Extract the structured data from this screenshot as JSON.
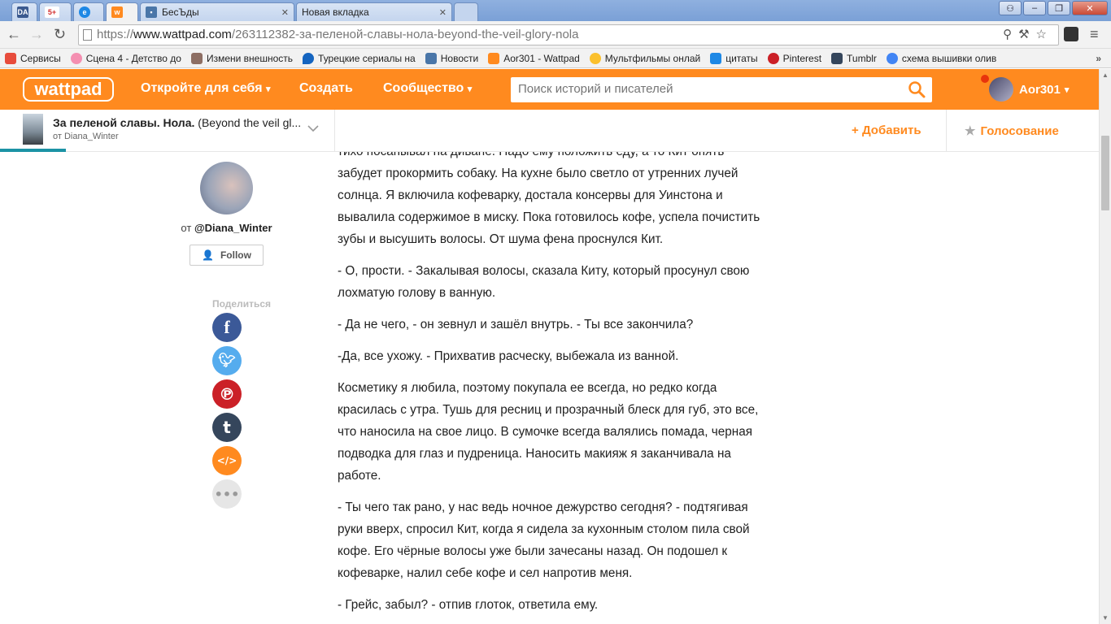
{
  "browser": {
    "tabs": [
      {
        "label": "DA",
        "icon": "da-favicon"
      },
      {
        "label": "5+",
        "icon": "five-plus-favicon"
      },
      {
        "label": "",
        "icon": "ie-favicon"
      },
      {
        "label": "",
        "icon": "wattpad-favicon"
      },
      {
        "label": "БесЪды",
        "icon": "vk-favicon"
      },
      {
        "label": "Новая вкладка",
        "icon": "new-tab-favicon"
      }
    ],
    "url_prefix": "https://",
    "url_host": "www.wattpad.com",
    "url_path": "/263112382-за-пеленой-славы-нола-beyond-the-veil-glory-nola",
    "bookmarks": [
      {
        "label": "Сервисы",
        "color": "#e74c3c"
      },
      {
        "label": "Сцена 4 - Детство до",
        "color": "#f48fb1"
      },
      {
        "label": "Измени внешность",
        "color": "#8d6e63"
      },
      {
        "label": "Турецкие сериалы на",
        "color": "#1565c0"
      },
      {
        "label": "Новости",
        "color": "#4a76a8"
      },
      {
        "label": "Aor301 - Wattpad",
        "color": "#ff8a1f"
      },
      {
        "label": "Мультфильмы онлай",
        "color": "#fbc02d"
      },
      {
        "label": "цитаты",
        "color": "#1e88e5"
      },
      {
        "label": "Pinterest",
        "color": "#cb2027"
      },
      {
        "label": "Tumblr",
        "color": "#35465c"
      },
      {
        "label": "схема вышивки олив",
        "color": "#4285f4"
      }
    ]
  },
  "header": {
    "logo": "wattpad",
    "nav": [
      "Откройте для себя",
      "Создать",
      "Сообщество"
    ],
    "search_placeholder": "Поиск историй и писателей",
    "username": "Aor301"
  },
  "story": {
    "title": "За пеленой славы. Нола.",
    "title_rest": "(Beyond the veil gl...",
    "author_line": "от Diana_Winter",
    "add_label": "Добавить",
    "vote_label": "Голосование",
    "reading_progress": 0.06
  },
  "sidebar": {
    "by_prefix": "от",
    "by_author": "@Diana_Winter",
    "follow_label": "Follow",
    "share_label": "Поделиться"
  },
  "paragraphs": [
    "тихо посапывал на диване. Надо ему положить еду, а то Кит опять забудет прокормить собаку. На кухне было светло от утренних лучей солнца. Я включила кофеварку, достала консервы для Уинстона и вывалила содержимое в миску. Пока готовилось кофе, успела почистить зубы и высушить волосы. От шума фена проснулся Кит.",
    "- О, прости. - Закалывая волосы, сказала Киту, который просунул свою лохматую голову в ванную.",
    "- Да не чего, - он зевнул и зашёл внутрь. - Ты все закончила?",
    "-Да, все ухожу. - Прихватив расческу, выбежала из ванной.",
    "Косметику я любила, поэтому покупала ее всегда, но редко когда красилась с утра. Тушь для ресниц и прозрачный блеск для губ, это все, что наносила на свое лицо. В сумочке всегда валялись помада, черная подводка для глаз и пудреница. Наносить макияж я заканчивала на работе.",
    "- Ты чего так рано, у нас ведь ночное дежурство сегодня? - подтягивая руки вверх, спросил Кит, когда я сидела за кухонным столом пила свой кофе. Его чёрные волосы уже были зачесаны назад. Он подошел к кофеварке, налил себе кофе и сел напротив меня.",
    "- Грейс, забыл? - отпив глоток, ответила ему."
  ]
}
